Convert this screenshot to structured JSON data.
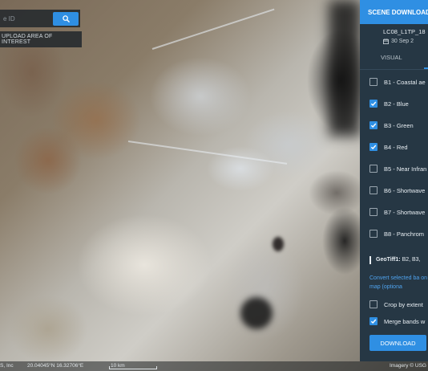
{
  "search": {
    "placeholder": "e ID",
    "button_icon": "search-icon"
  },
  "upload": {
    "label": "UPLOAD AREA OF INTEREST"
  },
  "panel": {
    "title": "SCENE DOWNLOAD",
    "scene_id": "LC08_L1TP_18",
    "scene_date": "30 Sep 2",
    "date_icon": "calendar-icon",
    "tabs": [
      {
        "label": "VISUAL"
      }
    ],
    "bands": [
      {
        "label": "B1 - Coastal ae",
        "checked": false
      },
      {
        "label": "B2 - Blue",
        "checked": true
      },
      {
        "label": "B3 - Green",
        "checked": true
      },
      {
        "label": "B4 - Red",
        "checked": true
      },
      {
        "label": "B5 - Near Infran",
        "checked": false
      },
      {
        "label": "B6 - Shortwave",
        "checked": false
      },
      {
        "label": "B7 - Shortwave",
        "checked": false
      },
      {
        "label": "B8 - Panchrom",
        "checked": false
      }
    ],
    "geotiff": {
      "label": "GeoTiff1:",
      "value": "B2, B3,"
    },
    "convert_text": "Convert selected ba on the map (optiona",
    "options": [
      {
        "label": "Crop by extent",
        "checked": false
      },
      {
        "label": "Merge bands w",
        "checked": true
      }
    ],
    "download_label": "DOWNLOAD",
    "accent_color": "#2f8fe3",
    "background_color": "#263744"
  },
  "footer": {
    "attribution_left": "S, Inc",
    "coordinates": "20.04045°N 16.32706°E",
    "scale": "10 km",
    "attribution_right": "Imagery © USG"
  }
}
